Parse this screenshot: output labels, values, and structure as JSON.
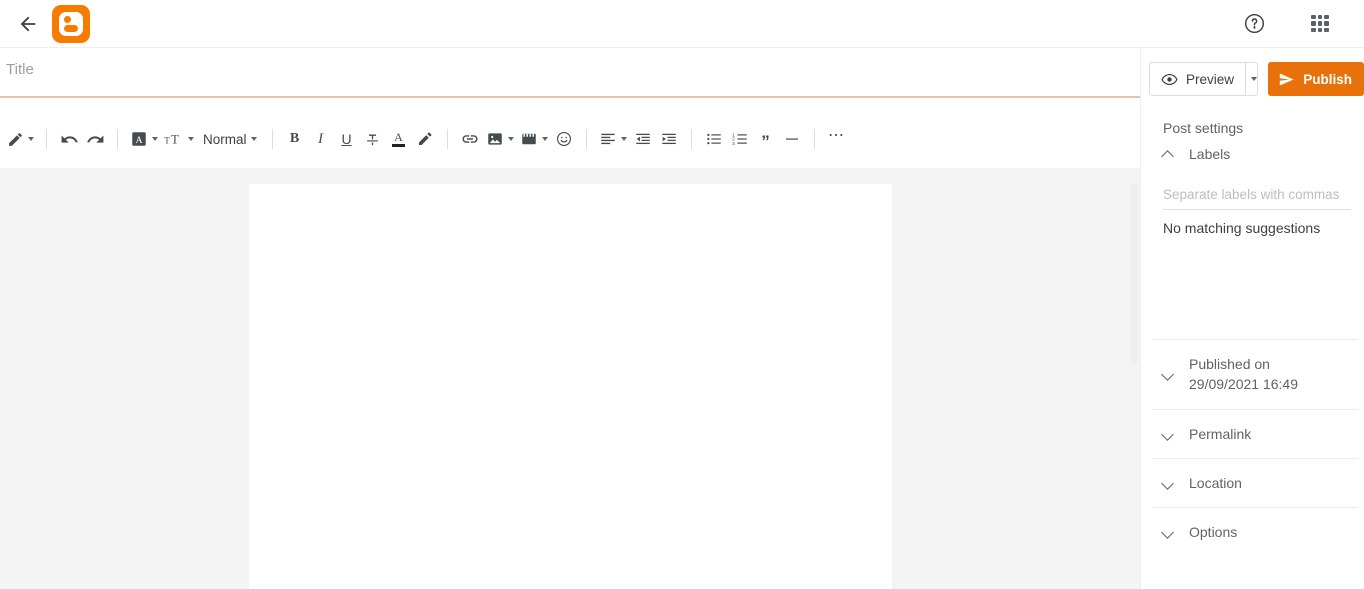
{
  "app": {
    "name": "Blogger",
    "accent_color": "#e8710a",
    "canvas_bg": "#f4f4f4"
  },
  "topbar": {
    "back_label": "Back",
    "logo_label": "Blogger",
    "help_label": "Help",
    "apps_label": "Google apps"
  },
  "editor": {
    "title_value": "",
    "title_placeholder": "Title",
    "body_value": ""
  },
  "toolbar": {
    "groups": [
      {
        "items": [
          {
            "name": "pen-icon",
            "label": "Pen / annotate",
            "caret": true
          }
        ]
      },
      {
        "items": [
          {
            "name": "undo-icon",
            "label": "Undo",
            "caret": false
          },
          {
            "name": "redo-icon",
            "label": "Redo",
            "caret": false
          }
        ]
      },
      {
        "items": [
          {
            "name": "font-family-icon",
            "label": "Font",
            "caret": true
          },
          {
            "name": "font-size-icon",
            "label": "Font size",
            "caret": true
          },
          {
            "name": "paragraph-style",
            "label": "Normal",
            "caret": true
          }
        ]
      },
      {
        "items": [
          {
            "name": "bold-icon",
            "label": "B",
            "caret": false
          },
          {
            "name": "italic-icon",
            "label": "I",
            "caret": false
          },
          {
            "name": "underline-icon",
            "label": "U",
            "caret": false
          },
          {
            "name": "strikethrough-icon",
            "label": "Strikethrough",
            "caret": false
          },
          {
            "name": "text-color-icon",
            "label": "A",
            "caret": false
          },
          {
            "name": "highlight-icon",
            "label": "Highlight",
            "caret": false
          }
        ]
      },
      {
        "items": [
          {
            "name": "link-icon",
            "label": "Insert link",
            "caret": false
          },
          {
            "name": "image-icon",
            "label": "Insert image",
            "caret": true
          },
          {
            "name": "video-icon",
            "label": "Insert video",
            "caret": true
          },
          {
            "name": "emoji-icon",
            "label": "Insert emoji",
            "caret": false
          }
        ]
      },
      {
        "items": [
          {
            "name": "align-icon",
            "label": "Alignment",
            "caret": true
          },
          {
            "name": "decrease-indent-icon",
            "label": "Decrease indent",
            "caret": false
          },
          {
            "name": "increase-indent-icon",
            "label": "Increase indent",
            "caret": false
          }
        ]
      },
      {
        "items": [
          {
            "name": "bulleted-list-icon",
            "label": "Bulleted list",
            "caret": false
          },
          {
            "name": "numbered-list-icon",
            "label": "Numbered list",
            "caret": false
          },
          {
            "name": "quote-icon",
            "label": "Quote",
            "caret": false
          },
          {
            "name": "horizontal-rule-icon",
            "label": "Horizontal line",
            "caret": false
          }
        ]
      },
      {
        "items": [
          {
            "name": "more-options-icon",
            "label": "More",
            "caret": false
          }
        ]
      }
    ],
    "paragraph_style": "Normal"
  },
  "sidebar": {
    "preview_label": "Preview",
    "publish_label": "Publish",
    "post_settings_title": "Post settings",
    "labels": {
      "heading": "Labels",
      "input_value": "",
      "input_placeholder": "Separate labels with commas",
      "suggestion_text": "No matching suggestions",
      "expanded": true
    },
    "sections": [
      {
        "name": "published-on",
        "heading": "Published on",
        "value": "29/09/2021 16:49",
        "expanded": false
      },
      {
        "name": "permalink",
        "heading": "Permalink",
        "value": "",
        "expanded": false
      },
      {
        "name": "location",
        "heading": "Location",
        "value": "",
        "expanded": false
      },
      {
        "name": "options",
        "heading": "Options",
        "value": "",
        "expanded": false
      }
    ]
  }
}
